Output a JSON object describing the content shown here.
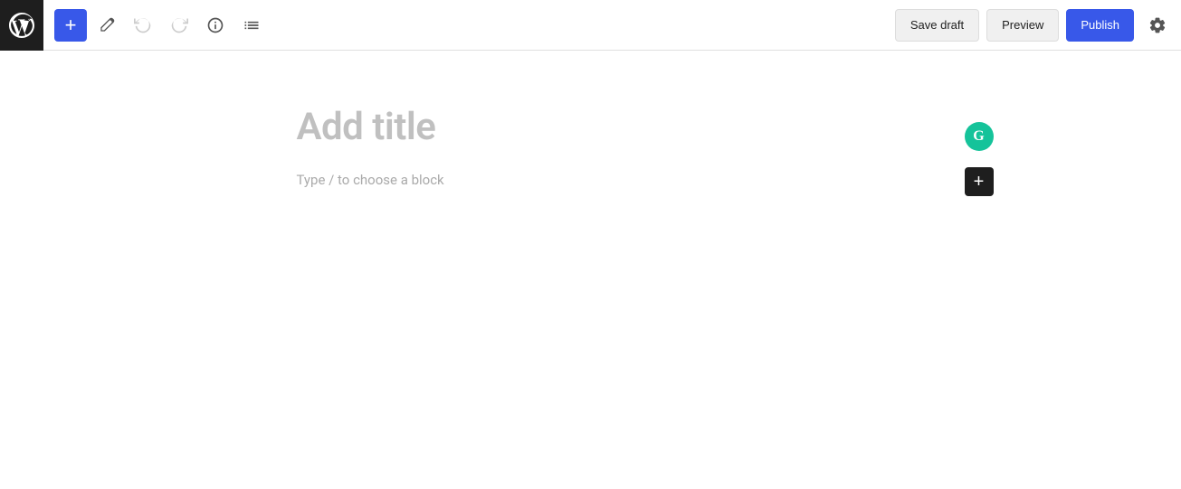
{
  "toolbar": {
    "add_block_label": "+",
    "save_draft_label": "Save draft",
    "preview_label": "Preview",
    "publish_label": "Publish"
  },
  "editor": {
    "title_placeholder": "Add title",
    "block_placeholder": "Type / to choose a block"
  },
  "colors": {
    "blue": "#3858e9",
    "dark": "#1e1e1e",
    "grammarly": "#15c39a"
  }
}
